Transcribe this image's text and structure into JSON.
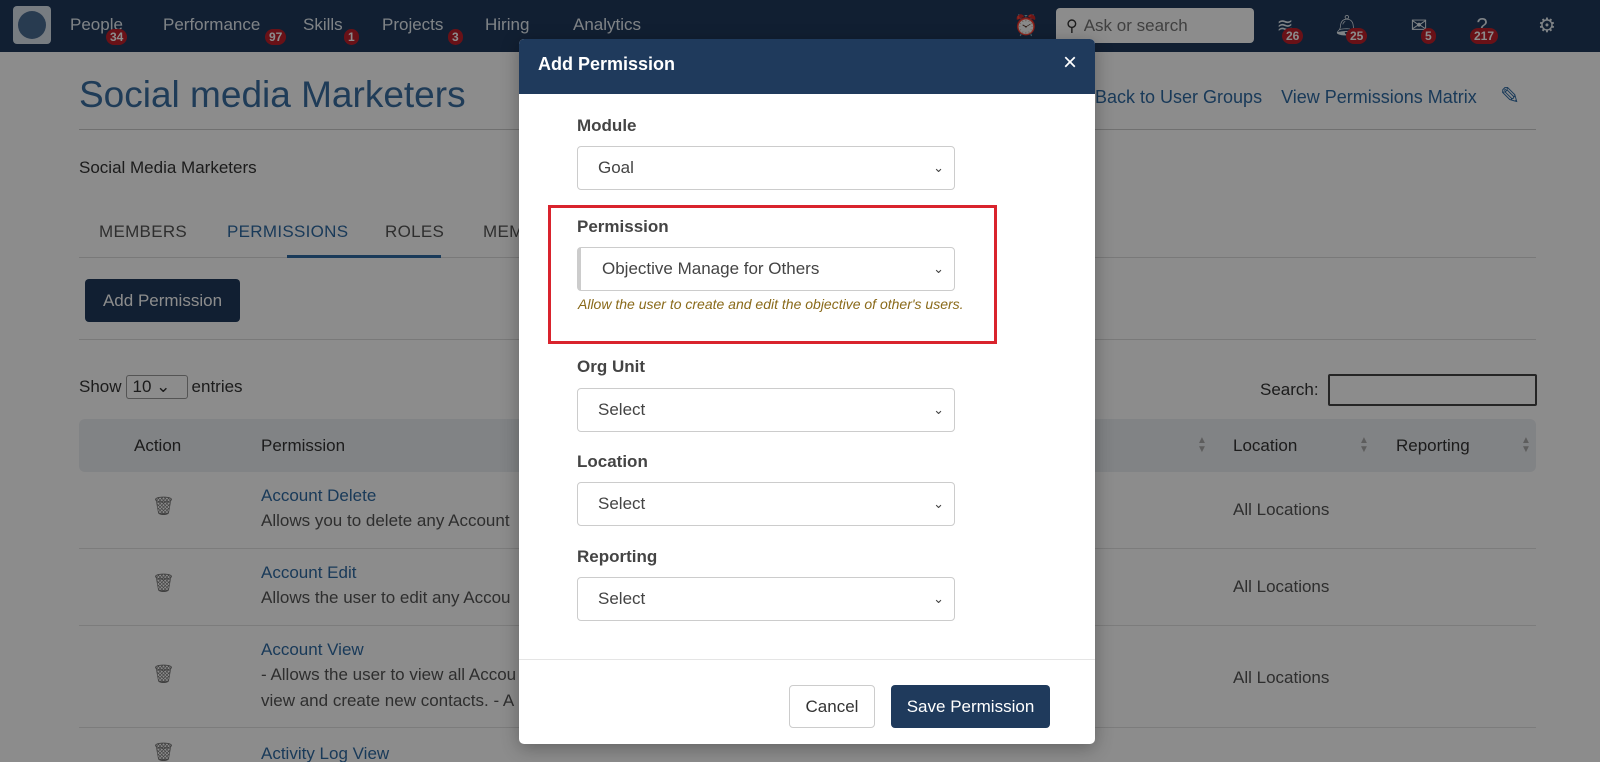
{
  "nav": {
    "items": [
      {
        "label": "People",
        "badge": "34"
      },
      {
        "label": "Performance",
        "badge": "97"
      },
      {
        "label": "Skills",
        "badge": "1"
      },
      {
        "label": "Projects",
        "badge": "3"
      },
      {
        "label": "Hiring",
        "badge": ""
      },
      {
        "label": "Analytics",
        "badge": ""
      }
    ],
    "search_placeholder": "Ask or search",
    "icon_badges": {
      "learning": "26",
      "notifications": "25",
      "messages": "5",
      "help": "217"
    }
  },
  "page": {
    "title": "Social media Marketers",
    "description": "Social Media Marketers",
    "back_link": "Back to User Groups",
    "matrix_link": "View Permissions Matrix"
  },
  "tabs": [
    "MEMBERS",
    "PERMISSIONS",
    "ROLES",
    "MEM"
  ],
  "add_permission_label": "Add Permission",
  "table": {
    "show_label": "Show",
    "entries_value": "10",
    "entries_label": "entries",
    "search_label": "Search:",
    "headers": {
      "action": "Action",
      "permission": "Permission",
      "location": "Location",
      "reporting": "Reporting"
    },
    "rows": [
      {
        "name": "Account Delete",
        "desc": "Allows you to delete any Account",
        "location": "All Locations"
      },
      {
        "name": "Account Edit",
        "desc": "Allows the user to edit any Accou",
        "location": "All Locations"
      },
      {
        "name": "Account View",
        "desc": "- Allows the user to view all Accou",
        "desc2": "view and create new contacts. - A",
        "location": "All Locations"
      },
      {
        "name": "Activity Log View",
        "desc": "",
        "location": ""
      }
    ]
  },
  "modal": {
    "title": "Add Permission",
    "module_label": "Module",
    "module_value": "Goal",
    "permission_label": "Permission",
    "permission_value": "Objective Manage for Others",
    "permission_help": "Allow the user to create and edit the objective of other's users.",
    "org_unit_label": "Org Unit",
    "org_unit_value": "Select",
    "location_label": "Location",
    "location_value": "Select",
    "reporting_label": "Reporting",
    "reporting_value": "Select",
    "cancel_label": "Cancel",
    "save_label": "Save Permission"
  },
  "colors": {
    "nav_bg": "#1f3a5c",
    "accent": "#2f6aa3",
    "badge": "#c0202a",
    "highlight": "#d9232d"
  }
}
